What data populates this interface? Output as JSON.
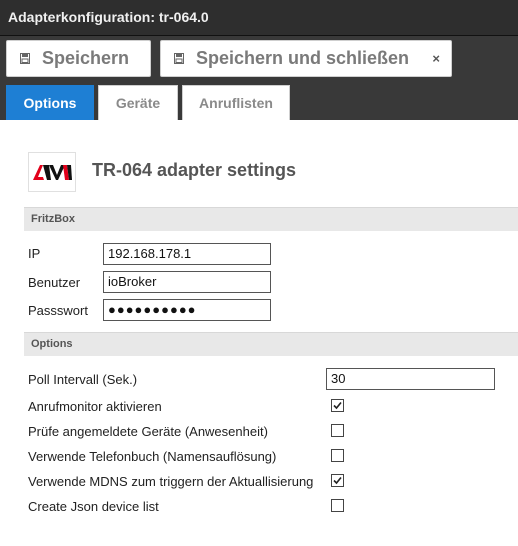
{
  "window": {
    "title": "Adapterkonfiguration: tr-064.0"
  },
  "toolbar": {
    "save_label": "Speichern",
    "save_close_label": "Speichern und schließen",
    "close_glyph": "×"
  },
  "tabs": [
    {
      "label": "Options",
      "active": true
    },
    {
      "label": "Geräte",
      "active": false
    },
    {
      "label": "Anruflisten",
      "active": false
    }
  ],
  "page": {
    "title": "TR-064 adapter settings"
  },
  "fritzbox": {
    "section_label": "FritzBox",
    "ip_label": "IP",
    "ip_value": "192.168.178.1",
    "user_label": "Benutzer",
    "user_value": "ioBroker",
    "password_label": "Passswort",
    "password_value": "●●●●●●●●●●"
  },
  "options": {
    "section_label": "Options",
    "poll_label": "Poll Intervall (Sek.)",
    "poll_value": "30",
    "items": [
      {
        "label": "Anrufmonitor aktivieren",
        "checked": true
      },
      {
        "label": "Prüfe angemeldete Geräte (Anwesenheit)",
        "checked": false
      },
      {
        "label": "Verwende Telefonbuch (Namensauflösung)",
        "checked": false
      },
      {
        "label": "Verwende MDNS zum triggern der Aktuallisierung",
        "checked": true
      },
      {
        "label": "Create Json device list",
        "checked": false
      }
    ]
  },
  "colors": {
    "accent": "#1e7fd4",
    "toolbar": "#393939",
    "titlebar": "#2e2e2e",
    "section": "#e8e8e8"
  }
}
